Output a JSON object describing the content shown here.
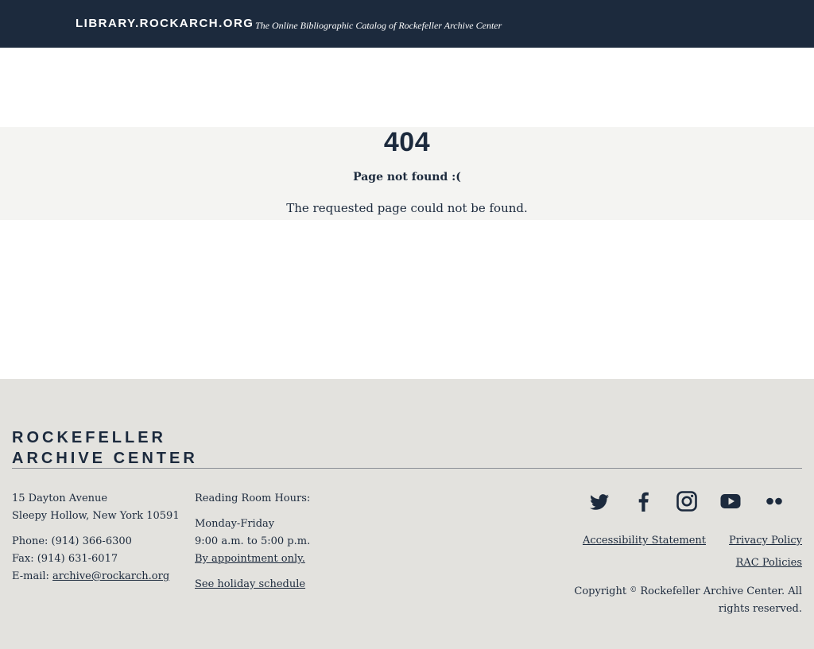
{
  "header": {
    "site_name": "LIBRARY.ROCKARCH.ORG",
    "tagline": "The Online Bibliographic Catalog of Rockefeller Archive Center"
  },
  "error": {
    "code": "404",
    "title": "Page not found :(",
    "message": "The requested page could not be found."
  },
  "footer": {
    "logo_line1": "ROCKEFELLER",
    "logo_line2": "ARCHIVE CENTER",
    "address": {
      "street": "15 Dayton Avenue",
      "city": "Sleepy Hollow, New York 10591",
      "phone": "Phone: (914) 366-6300",
      "fax": "Fax: (914) 631-6017",
      "email_label": "E-mail:",
      "email": "archive@rockarch.org"
    },
    "hours": {
      "heading": "Reading Room Hours:",
      "days": "Monday-Friday",
      "time": "9:00 a.m. to 5:00 p.m.",
      "appointment": "By appointment only.",
      "holiday_link": "See holiday schedule"
    },
    "social": [
      {
        "icon": "twitter-icon"
      },
      {
        "icon": "facebook-icon"
      },
      {
        "icon": "instagram-icon"
      },
      {
        "icon": "youtube-icon"
      },
      {
        "icon": "flickr-icon"
      }
    ],
    "links": {
      "accessibility": "Accessibility Statement",
      "privacy": "Privacy Policy",
      "policies": "RAC Policies"
    },
    "copyright_prefix": "Copyright",
    "copyright_symbol": "©",
    "copyright_text": "Rockefeller Archive Center. All rights reserved."
  },
  "colors": {
    "navy": "#1c2a3d",
    "band": "#f4f4f2",
    "footer_bg": "#e3e2de"
  }
}
